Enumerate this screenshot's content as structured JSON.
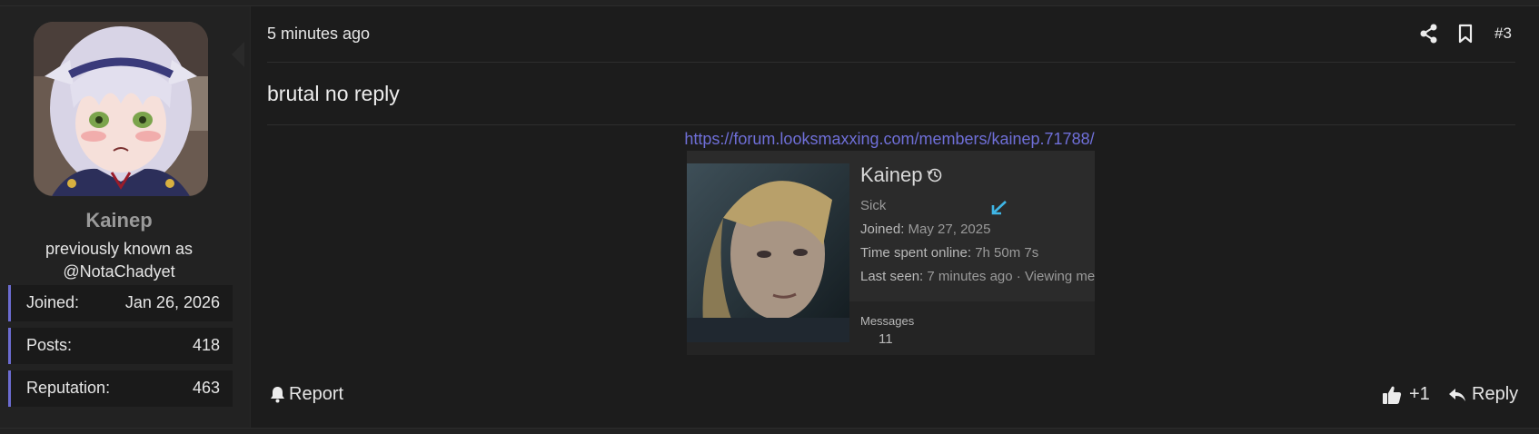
{
  "user": {
    "name": "Kainep",
    "previously_known_line1": "previously known as",
    "previously_known_line2": "@NotaChadyet",
    "stats": [
      {
        "key": "Joined:",
        "value": "Jan 26, 2026"
      },
      {
        "key": "Posts:",
        "value": "418"
      },
      {
        "key": "Reputation:",
        "value": "463"
      }
    ]
  },
  "post": {
    "time": "5 minutes ago",
    "number": "#3",
    "text": "brutal no reply",
    "link": "https://forum.looksmaxxing.com/members/kainep.71788/",
    "embed": {
      "name": "Kainep",
      "status": "Sick",
      "joined_label": "Joined:",
      "joined_value": "May 27, 2025",
      "online_label": "Time spent online:",
      "online_value": "7h 50m 7s",
      "seen_label": "Last seen:",
      "seen_value": "7 minutes ago · Viewing me",
      "messages_label": "Messages",
      "messages_value": "11"
    }
  },
  "actions": {
    "report": "Report",
    "like_count": "+1",
    "reply": "Reply"
  },
  "icons": {
    "share": "share-icon",
    "bookmark": "bookmark-icon",
    "bell": "bell-icon",
    "thumbs_up": "thumbs-up-icon",
    "reply": "reply-icon",
    "history": "history-icon"
  },
  "colors": {
    "accent": "#6c6cd0",
    "link": "#6f6fd8",
    "background": "#1c1c1c",
    "panel": "#222222"
  }
}
